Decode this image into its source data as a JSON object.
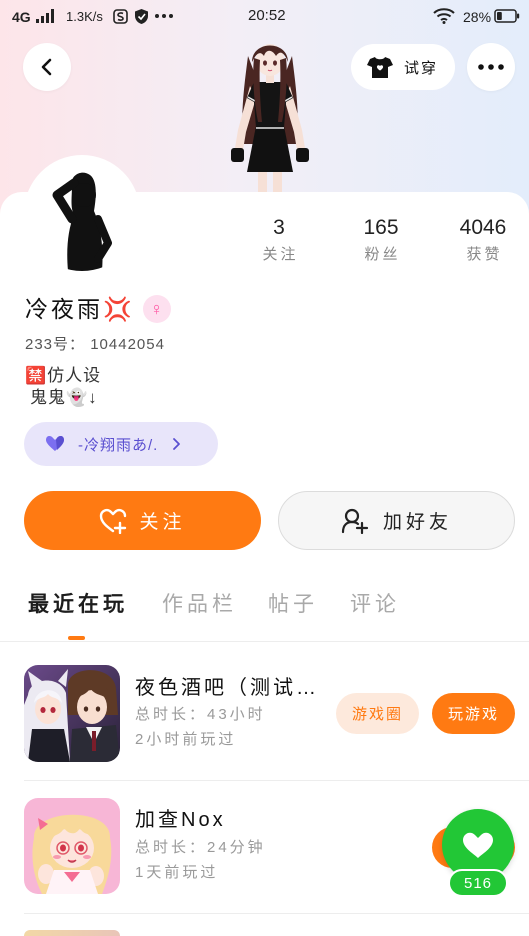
{
  "status_bar": {
    "network": "4G",
    "speed": "1.3K/s",
    "time": "20:52",
    "battery": "28%",
    "icons": [
      "signal-icon",
      "app-notification-icon",
      "shield-icon",
      "more-notifications-icon",
      "wifi-icon",
      "battery-icon"
    ]
  },
  "header": {
    "back_icon": "chevron-left-icon",
    "try_on_label": "试穿",
    "try_on_icon": "shirt-icon",
    "more_icon": "more-icon"
  },
  "profile": {
    "stats": [
      {
        "value": "3",
        "label": "关注"
      },
      {
        "value": "165",
        "label": "粉丝"
      },
      {
        "value": "4046",
        "label": "获赞"
      }
    ],
    "name": "冷夜雨💢",
    "gender_symbol": "♀",
    "id_line": "233号： 10442054",
    "bio_line1": "🈲仿人设",
    "bio_line2": "鬼鬼👻↓",
    "tag_label": "-冷翔雨あ/.",
    "tag_icon": "heart-icon"
  },
  "actions": {
    "follow_label": "关注",
    "follow_icon": "heart-plus-icon",
    "add_friend_label": "加好友",
    "add_friend_icon": "user-plus-icon"
  },
  "tabs": [
    {
      "label": "最近在玩",
      "active": true
    },
    {
      "label": "作品栏",
      "active": false
    },
    {
      "label": "帖子",
      "active": false
    },
    {
      "label": "评论",
      "active": false
    }
  ],
  "games": [
    {
      "title": "夜色酒吧（测试…",
      "total_time": "总时长：43小时",
      "last_played": "2小时前玩过",
      "circle_label": "游戏圈",
      "play_label": "玩游戏"
    },
    {
      "title": "加查Nox",
      "total_time": "总时长：24分钟",
      "last_played": "1天前玩过"
    }
  ],
  "floating": {
    "icon": "heart-icon",
    "like_count": "516"
  },
  "colors": {
    "accent": "#ff7a12",
    "accent_soft": "#fde9dc",
    "tag_bg": "#e8e5fa",
    "tag_text": "#5a4fd0",
    "like_green": "#22c736",
    "gender_pink": "#ff5aa5",
    "gender_bg": "#fde0ef"
  }
}
